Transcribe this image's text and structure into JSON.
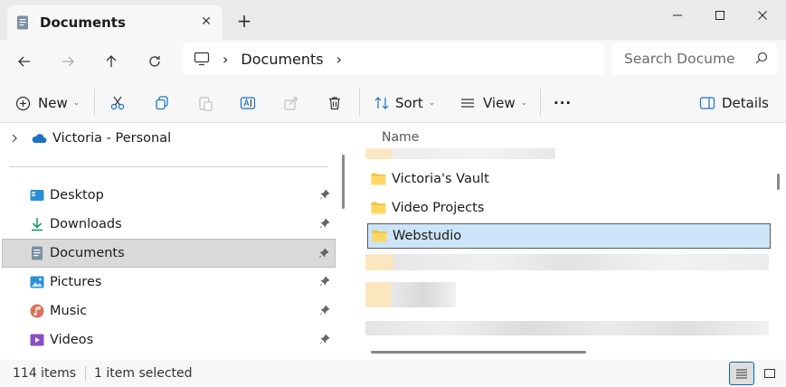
{
  "tab": {
    "title": "Documents",
    "close": "✕",
    "new_tab": "+"
  },
  "window": {
    "minimize": "—",
    "maximize": "☐",
    "close": "✕"
  },
  "address": {
    "separator": "›",
    "crumb": "Documents",
    "trailing": "›"
  },
  "search": {
    "placeholder": "Search Docume"
  },
  "toolbar": {
    "new_label": "New",
    "sort_label": "Sort",
    "view_label": "View",
    "more_label": "···",
    "details_label": "Details",
    "chevron": "⌄"
  },
  "sidebar": {
    "tree_item": "Victoria - Personal",
    "items": [
      {
        "label": "Desktop"
      },
      {
        "label": "Downloads"
      },
      {
        "label": "Documents"
      },
      {
        "label": "Pictures"
      },
      {
        "label": "Music"
      },
      {
        "label": "Videos"
      }
    ]
  },
  "content": {
    "column_name": "Name",
    "rows": [
      {
        "name": "Victoria's Vault"
      },
      {
        "name": "Video Projects"
      },
      {
        "name": "Webstudio"
      }
    ]
  },
  "status": {
    "count": "114 items",
    "selected": "1 item selected"
  },
  "colors": {
    "accent": "#0067c0",
    "folder": "#f6c342",
    "selection": "#cce4f7"
  }
}
